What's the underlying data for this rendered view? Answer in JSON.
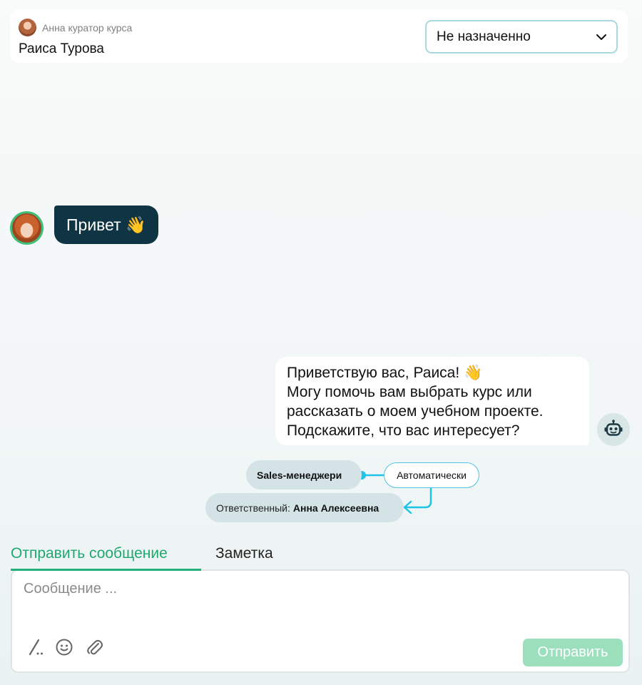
{
  "header": {
    "curator_label": "Анна куратор курса",
    "client_name": "Раиса Турова",
    "assign_select": {
      "value": "Не назначенно",
      "icon": "chevron-down-icon"
    }
  },
  "messages": {
    "incoming": {
      "text": "Привет 👋"
    },
    "outgoing": {
      "lines": [
        "Приветствую вас, Раиса! 👋",
        "Могу помочь вам выбрать курс или",
        "рассказать о моем учебном проекте.",
        "Подскажите, что вас интересует?"
      ],
      "avatar_icon": "robot-icon"
    }
  },
  "routing": {
    "group": "Sales-менеджери",
    "mode": "Автоматически",
    "responsible_label": "Ответственный:",
    "responsible_name": "Анна Алексеевна",
    "accent_color": "#1fc3e8"
  },
  "composer": {
    "tabs": [
      {
        "label": "Отправить сообщение",
        "active": true
      },
      {
        "label": "Заметка",
        "active": false
      }
    ],
    "placeholder": "Сообщение ...",
    "value": "",
    "tool_icons": [
      "slash-command-icon",
      "emoji-icon",
      "paperclip-icon"
    ],
    "send_label": "Отправить",
    "accent_color": "#1fa870"
  }
}
